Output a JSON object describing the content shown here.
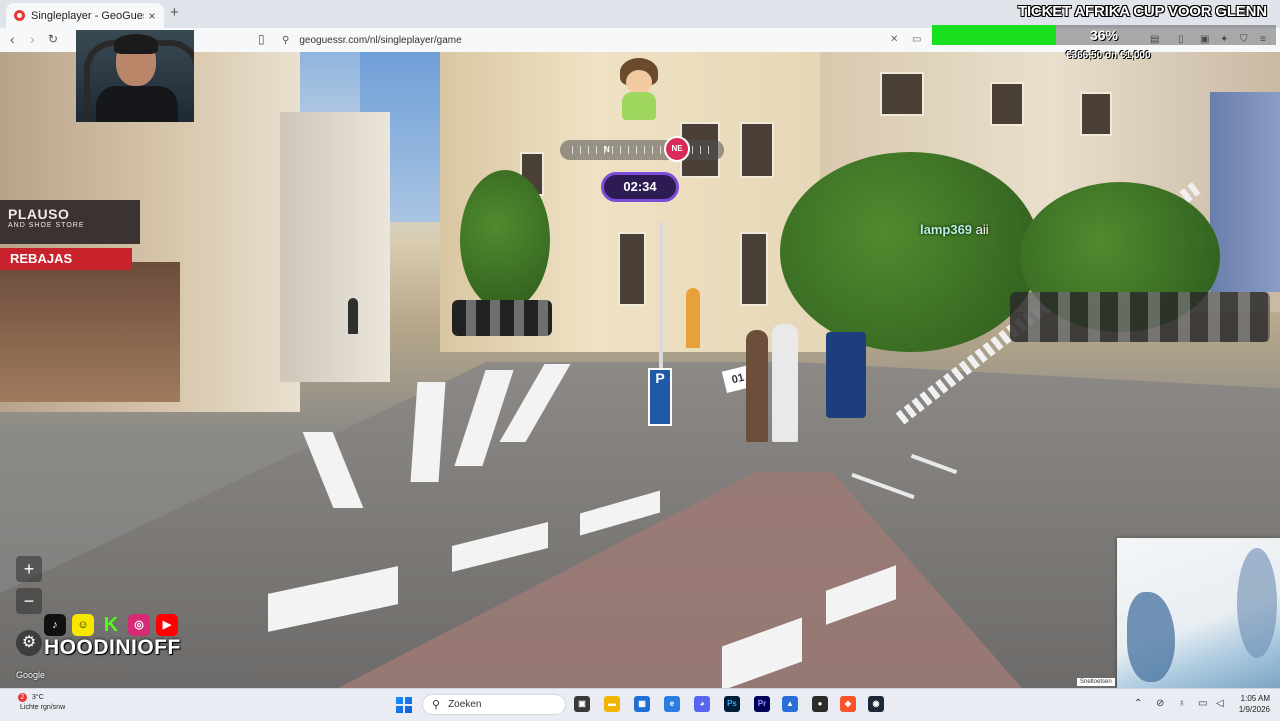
{
  "browser": {
    "tab_title": "Singleplayer - GeoGuessr",
    "new_tab": "+",
    "tab_close": "×",
    "url": "geoguessr.com/nl/singleplayer/game"
  },
  "game": {
    "timer": "02:34",
    "compass_n": "N",
    "compass_ne": "NE",
    "zoom_in": "+",
    "zoom_out": "−",
    "google_label": "Google",
    "map_button": "Sneltoetsen"
  },
  "scene": {
    "shop_sign": "PLAUSO",
    "shop_sign_sub": "AND SHOE STORE",
    "sale_sign": "REBAJAS",
    "parking_sign": "P",
    "board_number": "01"
  },
  "stream": {
    "chat_user": "lamp369",
    "chat_message": "aii",
    "handle": "HOODINIOFF",
    "goal_title": "TICKET AFRIKA CUP VOOR GLENN",
    "goal_percent": "36%",
    "goal_progress": 0.36,
    "goal_amount": "€366,50 on €1,000",
    "social": [
      {
        "name": "tiktok-icon",
        "glyph": "♪",
        "color": "#111111"
      },
      {
        "name": "snapchat-icon",
        "glyph": "☺",
        "color": "#f7e600"
      },
      {
        "name": "kick-icon",
        "glyph": "K",
        "color": "#53fc18"
      },
      {
        "name": "instagram-icon",
        "glyph": "◎",
        "color": "#d62976"
      },
      {
        "name": "youtube-icon",
        "glyph": "▶",
        "color": "#ff0000"
      }
    ]
  },
  "taskbar": {
    "weather_temp": "3°C",
    "weather_desc": "Lichte rgn/snw",
    "weather_badge": "2",
    "search_placeholder": "Zoeken",
    "time": "1:05 AM",
    "date": "1/9/2026"
  },
  "colors": {
    "goal_fill": "#19e01f",
    "timer_border": "#7b4dd8",
    "compass_marker": "#d92b5a"
  }
}
